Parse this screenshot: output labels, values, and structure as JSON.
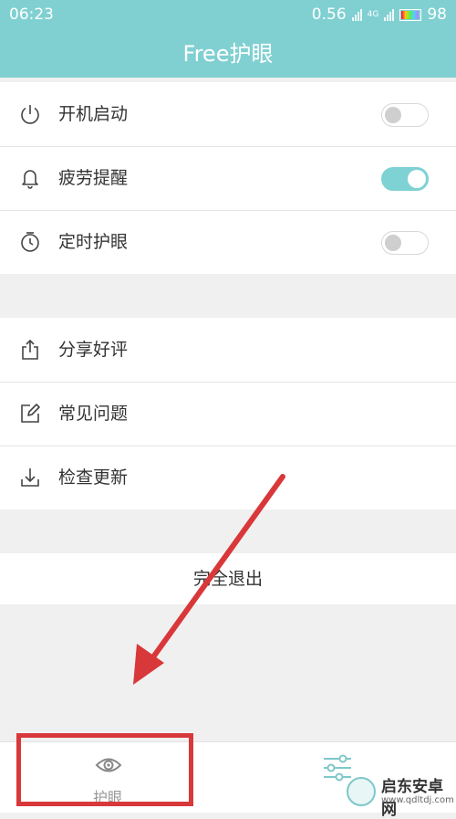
{
  "status_bar": {
    "time": "06:23",
    "net_speed": "0.56",
    "network_type": "4G",
    "battery": "98"
  },
  "app_bar": {
    "title": "Free护眼"
  },
  "settings": {
    "items": [
      {
        "label": "开机启动",
        "icon": "power-icon",
        "enabled": false
      },
      {
        "label": "疲劳提醒",
        "icon": "bell-icon",
        "enabled": true
      },
      {
        "label": "定时护眼",
        "icon": "timer-icon",
        "enabled": false
      }
    ]
  },
  "more": {
    "items": [
      {
        "label": "分享好评",
        "icon": "share-icon"
      },
      {
        "label": "常见问题",
        "icon": "edit-icon"
      },
      {
        "label": "检查更新",
        "icon": "download-icon"
      }
    ]
  },
  "exit_label": "完全退出",
  "bottom_nav": {
    "tabs": [
      {
        "label": "护眼",
        "icon": "eye-icon",
        "active": true
      },
      {
        "label": "",
        "icon": "sliders-icon",
        "active": false
      }
    ]
  },
  "annotation": {
    "color": "#d9383a"
  },
  "theme": {
    "accent": "#80d0d2",
    "background": "#f1f0f1"
  },
  "watermark": {
    "title": "启东安卓网",
    "url": "www.qdltdj.com"
  }
}
